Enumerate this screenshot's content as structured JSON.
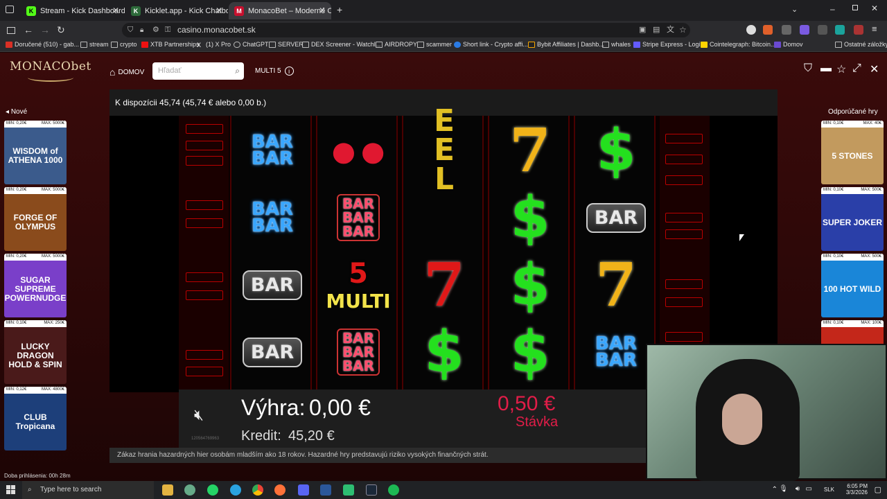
{
  "browser": {
    "tabs": [
      {
        "label": "Stream - Kick Dashboard",
        "icon": "kick-icon",
        "color": "#53fc18",
        "active": false
      },
      {
        "label": "Kicklet.app - Kick Chatbot and ...",
        "icon": "kicklet-icon",
        "color": "#2d6a3a",
        "active": false
      },
      {
        "label": "MonacoBet – Moderné Online ...",
        "icon": "monacobet-icon",
        "color": "#c8102e",
        "active": true
      }
    ],
    "new_tab": "+",
    "url": "casino.monacobet.sk",
    "bookmarks": [
      "Doručené (510) - gab...",
      "stream",
      "crypto",
      "XTB Partnerships",
      "(1) X Pro",
      "ChatGPT",
      "SERVER",
      "DEX Screener - Watchl...",
      "AIRDROPY",
      "scammer",
      "Short link - Crypto affi...",
      "Bybit Affiliates | Dashb...",
      "whales",
      "Stripe Express - Login",
      "Cointelegraph: Bitcoin...",
      "Domov"
    ],
    "other_bookmarks": "Ostatné záložky"
  },
  "site": {
    "logo": "MONACObet",
    "home": "DOMOV",
    "search_placeholder": "Hľadať",
    "game_name": "MULTI 5",
    "available": "K dispozícii 45,74 (45,74 € alebo 0,00 b.)",
    "left_title": "Nové",
    "right_title": "Odporúčané hry",
    "left_games": [
      {
        "min": "MIN: 0,20€",
        "max": "MAX: 5000€",
        "name": "WISDOM of ATHENA 1000",
        "bg": "#3b5b8c"
      },
      {
        "min": "MIN: 0,20€",
        "max": "MAX: 5000€",
        "name": "FORGE OF OLYMPUS",
        "bg": "#8a4b1c"
      },
      {
        "min": "MIN: 0,20€",
        "max": "MAX: 5000€",
        "name": "SUGAR SUPREME POWERNUDGE",
        "bg": "#7a3fc9"
      },
      {
        "min": "MIN: 0,10€",
        "max": "MAX: 250€",
        "name": "LUCKY DRAGON HOLD & SPIN",
        "bg": "#4a1a1a"
      },
      {
        "min": "MIN: 0,12€",
        "max": "MAX: 4800€",
        "name": "CLUB Tropicana",
        "bg": "#1d3f7a"
      }
    ],
    "right_games": [
      {
        "min": "MIN: 0,10€",
        "max": "MAX: 40€",
        "name": "5 STONES",
        "bg": "#c29a5e"
      },
      {
        "min": "MIN: 0,10€",
        "max": "MAX: 500€",
        "name": "SUPER JOKER",
        "bg": "#2a3fa8"
      },
      {
        "min": "MIN: 0,10€",
        "max": "MAX: 500€",
        "name": "100 HOT WILD",
        "bg": "#1a86d8"
      },
      {
        "min": "MIN: 0,10€",
        "max": "MAX: 100€",
        "name": "",
        "bg": "#c4271a"
      }
    ],
    "win_label": "Výhra:",
    "win_value": "0,00 €",
    "credit_label": "Kredit:",
    "credit_value": "45,20 €",
    "stake_value": "0,50 €",
    "stake_label": "Stávka",
    "game_id": "120564769963",
    "disclaimer": "Zákaz hrania hazardných hier osobám mladším ako 18 rokov. Hazardné hry predstavujú riziko vysokých finančných strát.",
    "session": "Doba prihlásenia: 00h 28m"
  },
  "reels": [
    [
      "BAR BAR",
      "BAR BAR",
      "BAR",
      "BAR"
    ],
    [
      "cherry",
      "BAR BAR BAR",
      "5 MULTI",
      "BAR BAR BAR"
    ],
    [
      "bell",
      "",
      "7 red",
      "$"
    ],
    [
      "7 gold",
      "$",
      "$",
      "$"
    ],
    [
      "$",
      "BAR",
      "7 gold",
      "BAR BAR"
    ]
  ],
  "taskbar": {
    "search": "Type here to search",
    "lang": "SLK",
    "time": "6:05 PM",
    "date": "3/3/2026"
  },
  "colors": {
    "accent": "#c8102e",
    "stake": "#e11d48",
    "green": "#24e01e"
  }
}
